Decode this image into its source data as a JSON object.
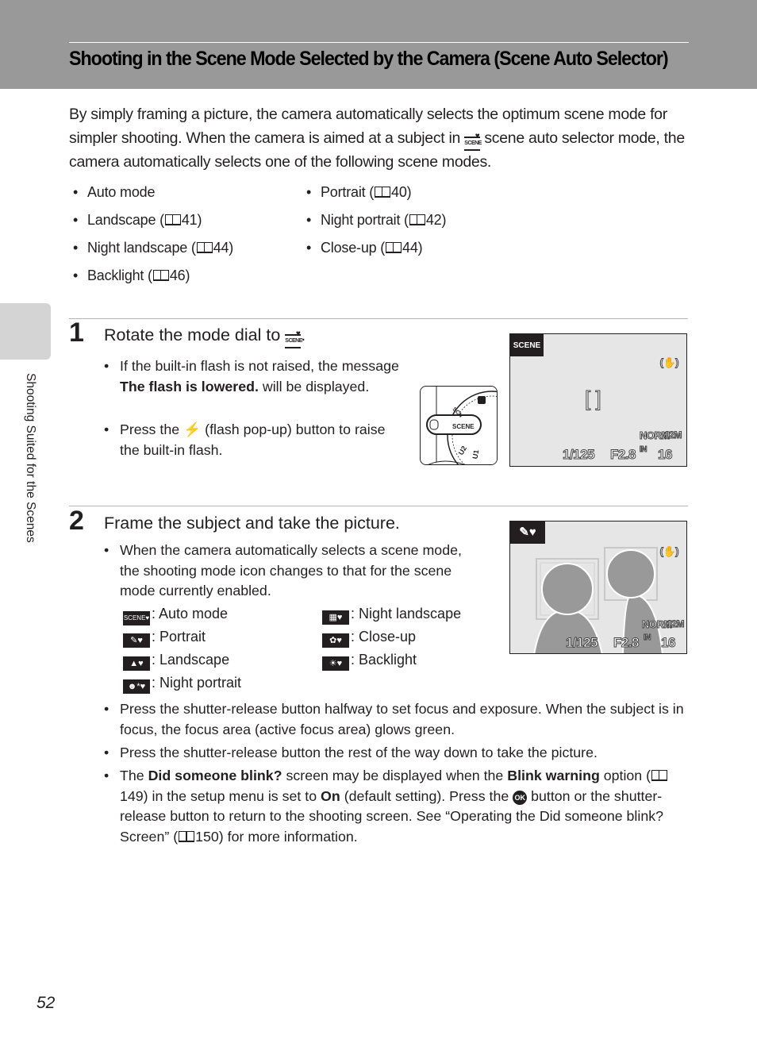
{
  "header": {
    "title": "Shooting in the Scene Mode Selected by the Camera (Scene Auto Selector)"
  },
  "intro": {
    "text_part1": "By simply framing a picture, the camera automatically selects the optimum scene mode for simpler shooting. When the camera is aimed at a subject in ",
    "icon": "SCENE",
    "text_part2": " scene auto selector mode, the camera automatically selects one of the following scene modes."
  },
  "scene_modes": [
    {
      "label": "Auto mode",
      "page": ""
    },
    {
      "label": "Portrait (",
      "page": "40)"
    },
    {
      "label": "Landscape (",
      "page": "41)"
    },
    {
      "label": "Night portrait (",
      "page": "42)"
    },
    {
      "label": "Night landscape (",
      "page": "44)"
    },
    {
      "label": "Close-up (",
      "page": "44)"
    },
    {
      "label": "Backlight (",
      "page": "46)"
    }
  ],
  "side_tab": {
    "label": "Shooting Suited for the Scenes"
  },
  "bullet_char": "•",
  "step1": {
    "number": "1",
    "title": "Rotate the mode dial to ",
    "title_end": ".",
    "bullets": [
      {
        "pre": "If the built-in flash is not raised, the message ",
        "bold": "The flash is lowered.",
        "post": " will be displayed."
      },
      {
        "pre": "Press the ",
        "icon": "⚡",
        "post": " (flash pop-up) button to raise the built-in flash."
      }
    ],
    "dial": {
      "labels": [
        "SCENE",
        "U2",
        "U1",
        "SCN"
      ]
    },
    "lcd": {
      "mode_icon": "SCENE",
      "vr_icon": "(✋)",
      "focus_brackets": "[   ]",
      "quality": "NORM",
      "image_size": "12M",
      "shutter": "1/125",
      "aperture": "F2.8",
      "memory": "IN",
      "exposures": "16"
    }
  },
  "step2": {
    "number": "2",
    "title": "Frame the subject and take the picture.",
    "bullet_intro": "When the camera automatically selects a scene mode, the shooting mode icon changes to that for the scene mode currently enabled.",
    "icon_legend": [
      {
        "icon": "SCENE♥",
        "label": ": Auto mode"
      },
      {
        "icon": "✎♥",
        "label": ": Portrait"
      },
      {
        "icon": "▲♥",
        "label": ": Landscape"
      },
      {
        "icon": "☻*♥",
        "label": ": Night portrait"
      },
      {
        "icon": "▦♥",
        "label": ": Night landscape"
      },
      {
        "icon": "✿♥",
        "label": ": Close-up"
      },
      {
        "icon": "☀♥",
        "label": ": Backlight"
      }
    ],
    "bullets": [
      {
        "text": "Press the shutter-release button halfway to set focus and exposure. When the subject is in focus, the focus area (active focus area) glows green."
      },
      {
        "text": "Press the shutter-release button the rest of the way down to take the picture."
      }
    ],
    "blink_bullet": {
      "t1": "The ",
      "b1": "Did someone blink?",
      "t2": " screen may be displayed when the ",
      "b2": "Blink warning",
      "t3": " option (",
      "p1": "149) in the setup menu is set to ",
      "b3": "On",
      "t4": " (default setting). Press the ",
      "ok": "OK",
      "t5": " button or the shutter-release button to return to the shooting screen. See “Operating the Did someone blink? Screen” (",
      "p2": "150) for more information."
    },
    "lcd": {
      "mode_icon": "✎♥",
      "vr_icon": "(✋)",
      "quality": "NORM",
      "image_size": "12M",
      "shutter": "1/125",
      "aperture": "F2.8",
      "memory": "IN",
      "exposures": "16"
    }
  },
  "page_number": "52"
}
